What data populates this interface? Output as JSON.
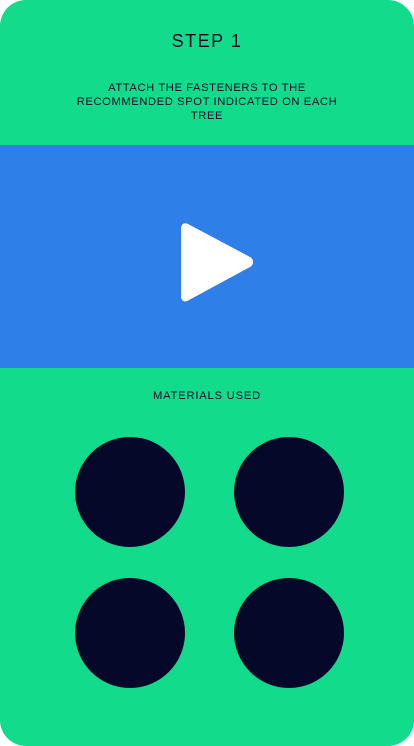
{
  "step": {
    "title": "STEP 1",
    "instructions": "ATTACH THE FASTENERS TO THE RECOMMENDED SPOT INDICATED ON EACH TREE"
  },
  "video": {
    "play_icon": "play-icon"
  },
  "materials": {
    "title": "MATERIALS USED",
    "items_count_shown": 4
  },
  "colors": {
    "background": "#12db8c",
    "video_background": "#2f7fe9",
    "text": "#050829",
    "material_circle": "#050829",
    "play_icon": "#ffffff"
  }
}
